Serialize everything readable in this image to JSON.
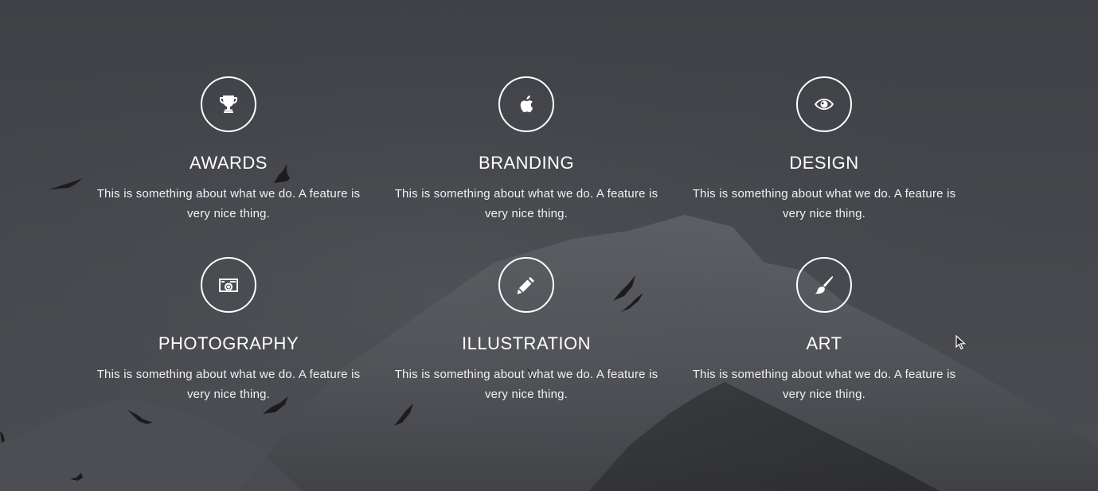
{
  "background": {
    "base_color": "#44464b",
    "mountain_color": "#5e6066",
    "bird_color": "#1c1c1e"
  },
  "features": [
    {
      "icon": "trophy-icon",
      "title": "AWARDS",
      "description": "This is something about what we do. A feature is very nice thing."
    },
    {
      "icon": "apple-icon",
      "title": "BRANDING",
      "description": "This is something about what we do. A feature is very nice thing."
    },
    {
      "icon": "eye-icon",
      "title": "DESIGN",
      "description": "This is something about what we do. A feature is very nice thing."
    },
    {
      "icon": "camera-icon",
      "title": "PHOTOGRAPHY",
      "description": "This is something about what we do. A feature is very nice thing."
    },
    {
      "icon": "pencil-icon",
      "title": "ILLUSTRATION",
      "description": "This is something about what we do. A feature is very nice thing."
    },
    {
      "icon": "paintbrush-icon",
      "title": "ART",
      "description": "This is something about what we do. A feature is very nice thing."
    }
  ]
}
